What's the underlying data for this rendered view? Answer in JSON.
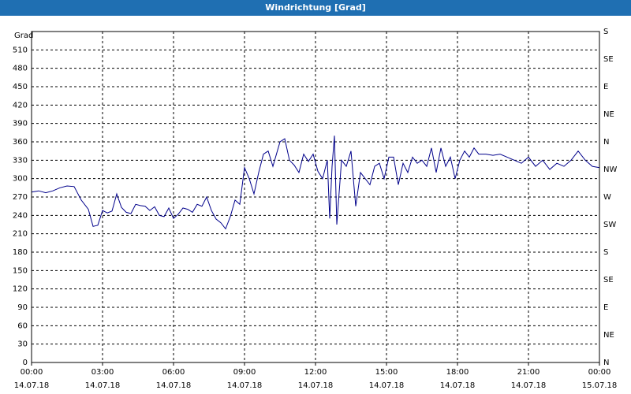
{
  "window": {
    "title": "Windrichtung [Grad]"
  },
  "chart_data": {
    "type": "line",
    "title": "Windrichtung [Grad]",
    "ylabel": "Grad",
    "ylim": [
      0,
      540
    ],
    "yticks": [
      0,
      30,
      60,
      90,
      120,
      150,
      180,
      210,
      240,
      270,
      300,
      330,
      360,
      390,
      420,
      450,
      480,
      510
    ],
    "right_axis_labels": [
      "N",
      "NE",
      "E",
      "SE",
      "S",
      "SW",
      "W",
      "NW",
      "N",
      "NE",
      "E",
      "SE",
      "S"
    ],
    "x_range_hours": [
      0,
      24
    ],
    "x_ticks": [
      {
        "time": "00:00",
        "date": "14.07.18"
      },
      {
        "time": "03:00",
        "date": "14.07.18"
      },
      {
        "time": "06:00",
        "date": "14.07.18"
      },
      {
        "time": "09:00",
        "date": "14.07.18"
      },
      {
        "time": "12:00",
        "date": "14.07.18"
      },
      {
        "time": "15:00",
        "date": "14.07.18"
      },
      {
        "time": "18:00",
        "date": "14.07.18"
      },
      {
        "time": "21:00",
        "date": "14.07.18"
      },
      {
        "time": "00:00",
        "date": "15.07.18"
      }
    ],
    "grid": true,
    "line_color": "#00008b",
    "series": [
      {
        "x": [
          0.0,
          0.3,
          0.6,
          0.9,
          1.2,
          1.5,
          1.8,
          2.1,
          2.4,
          2.6,
          2.8,
          3.0,
          3.2,
          3.4,
          3.6,
          3.8,
          4.0,
          4.2,
          4.4,
          4.6,
          4.8,
          5.0,
          5.2,
          5.4,
          5.6,
          5.8,
          6.0,
          6.2,
          6.4,
          6.6,
          6.8,
          7.0,
          7.2,
          7.4,
          7.6,
          7.8,
          8.0,
          8.2,
          8.4,
          8.6,
          8.8,
          9.0,
          9.2,
          9.4,
          9.6,
          9.8,
          10.0,
          10.2,
          10.5,
          10.7,
          10.9,
          11.1,
          11.3,
          11.5,
          11.7,
          11.9,
          12.1,
          12.3,
          12.5,
          12.6,
          12.7,
          12.8,
          12.9,
          13.1,
          13.3,
          13.5,
          13.7,
          13.9,
          14.1,
          14.3,
          14.5,
          14.7,
          14.9,
          15.1,
          15.3,
          15.5,
          15.7,
          15.9,
          16.1,
          16.3,
          16.5,
          16.7,
          16.9,
          17.1,
          17.3,
          17.5,
          17.7,
          17.9,
          18.1,
          18.3,
          18.5,
          18.7,
          18.9,
          19.2,
          19.5,
          19.8,
          20.1,
          20.4,
          20.7,
          21.0,
          21.3,
          21.6,
          21.9,
          22.2,
          22.5,
          22.8,
          23.1,
          23.4,
          23.7,
          24.0
        ],
        "y": [
          278,
          280,
          277,
          280,
          285,
          288,
          287,
          265,
          250,
          222,
          224,
          248,
          244,
          247,
          275,
          253,
          245,
          243,
          258,
          256,
          255,
          248,
          254,
          240,
          238,
          252,
          235,
          242,
          252,
          250,
          245,
          258,
          255,
          270,
          248,
          234,
          228,
          218,
          238,
          265,
          258,
          318,
          300,
          275,
          310,
          340,
          345,
          320,
          360,
          365,
          330,
          322,
          310,
          340,
          328,
          340,
          312,
          300,
          330,
          235,
          320,
          370,
          225,
          330,
          320,
          345,
          255,
          310,
          300,
          290,
          320,
          325,
          300,
          335,
          335,
          290,
          325,
          310,
          335,
          325,
          330,
          320,
          350,
          310,
          350,
          320,
          335,
          300,
          330,
          345,
          335,
          350,
          340,
          340,
          338,
          340,
          335,
          330,
          325,
          335,
          320,
          330,
          315,
          325,
          320,
          330,
          345,
          330,
          320,
          318
        ]
      }
    ]
  }
}
